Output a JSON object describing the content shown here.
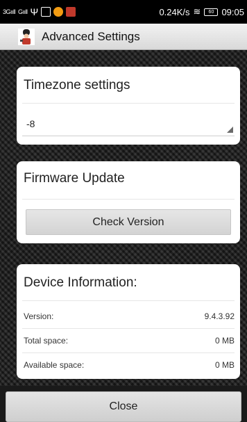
{
  "status_bar": {
    "signal_1": "3G",
    "signal_2": "G",
    "speed": "0.24K/s",
    "battery": "60",
    "time": "09:05"
  },
  "title_bar": {
    "icon": "app-guard-icon",
    "title": "Advanced Settings"
  },
  "timezone": {
    "title": "Timezone settings",
    "selected": "-8"
  },
  "firmware": {
    "title": "Firmware Update",
    "check_label": "Check Version"
  },
  "device": {
    "title": "Device Information:",
    "rows": [
      {
        "label": "Version:",
        "value": "9.4.3.92"
      },
      {
        "label": "Total space:",
        "value": "0 MB"
      },
      {
        "label": "Available space:",
        "value": "0 MB"
      }
    ]
  },
  "footer": {
    "close_label": "Close"
  }
}
